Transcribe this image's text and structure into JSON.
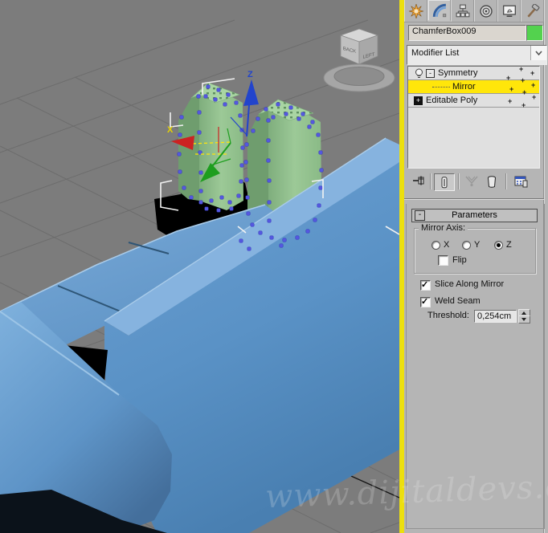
{
  "watermark": "www.dijitaldevs.com",
  "command_panel": {
    "tabs": [
      {
        "icon": "create-icon"
      },
      {
        "icon": "modify-icon",
        "active": true
      },
      {
        "icon": "hierarchy-icon"
      },
      {
        "icon": "motion-icon"
      },
      {
        "icon": "display-icon"
      },
      {
        "icon": "utilities-icon"
      }
    ],
    "object_name": "ChamferBox009",
    "object_color": "#53d24e",
    "modifier_list_label": "Modifier List",
    "modifier_stack": [
      {
        "label": "Symmetry",
        "icon": "bulb-icon",
        "expand_glyph": "-",
        "selected": false
      },
      {
        "label": "Mirror",
        "selected": true
      },
      {
        "label": "Editable Poly",
        "expand_glyph": "+",
        "selected": false
      }
    ],
    "stack_tools": [
      {
        "icon": "pin-stack-icon"
      },
      {
        "icon": "show-end-result-icon",
        "pressed": true
      },
      {
        "icon": "make-unique-icon",
        "disabled": true
      },
      {
        "icon": "remove-modifier-icon"
      },
      {
        "icon": "configure-modifier-sets-icon"
      }
    ],
    "rollout": {
      "title": "Parameters",
      "collapse_glyph": "-",
      "mirror_axis": {
        "label": "Mirror Axis:",
        "options": [
          {
            "label": "X",
            "selected": false
          },
          {
            "label": "Y",
            "selected": false
          },
          {
            "label": "Z",
            "selected": true
          }
        ],
        "flip_label": "Flip",
        "flip_checked": false
      },
      "slice_label": "Slice Along Mirror",
      "slice_checked": true,
      "weld_label": "Weld Seam",
      "weld_checked": true,
      "threshold_label": "Threshold:",
      "threshold_value": "0,254cm"
    }
  },
  "viewport": {
    "viewcube": {
      "left_face": "BACK",
      "right_face": "LEFT"
    },
    "gizmo": {
      "x_label": "X",
      "z_label": "Z"
    },
    "selected_row_color": "#ffe60a",
    "active_border_color": "#ecdf0e",
    "background_color": "#7c7c7c",
    "sofa_color": "#5e96c9",
    "cushion_color": "#93c290",
    "vertex_color": "#5558e0"
  }
}
